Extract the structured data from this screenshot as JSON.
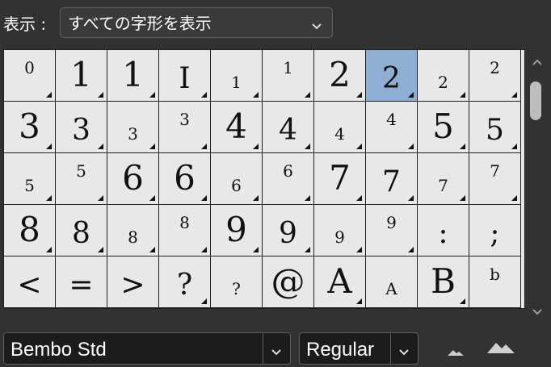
{
  "toolbar": {
    "show_label": "表示 :",
    "show_value": "すべての字形を表示"
  },
  "glyphs": [
    {
      "char": "0",
      "size": "sup",
      "alternates": true,
      "selected": false
    },
    {
      "char": "1",
      "size": "big",
      "alternates": true,
      "selected": false
    },
    {
      "char": "1",
      "size": "big",
      "alternates": true,
      "selected": false
    },
    {
      "char": "I",
      "size": "mid",
      "alternates": true,
      "selected": false
    },
    {
      "char": "1",
      "size": "small",
      "alternates": true,
      "selected": false
    },
    {
      "char": "1",
      "size": "sup",
      "alternates": true,
      "selected": false
    },
    {
      "char": "2",
      "size": "big",
      "alternates": true,
      "selected": false
    },
    {
      "char": "2",
      "size": "mid",
      "alternates": true,
      "selected": true
    },
    {
      "char": "2",
      "size": "small",
      "alternates": true,
      "selected": false
    },
    {
      "char": "2",
      "size": "sup",
      "alternates": true,
      "selected": false
    },
    {
      "char": "3",
      "size": "big",
      "alternates": true,
      "selected": false
    },
    {
      "char": "3",
      "size": "mid",
      "alternates": true,
      "selected": false
    },
    {
      "char": "3",
      "size": "small",
      "alternates": true,
      "selected": false
    },
    {
      "char": "3",
      "size": "sup",
      "alternates": true,
      "selected": false
    },
    {
      "char": "4",
      "size": "big",
      "alternates": true,
      "selected": false
    },
    {
      "char": "4",
      "size": "mid",
      "alternates": true,
      "selected": false
    },
    {
      "char": "4",
      "size": "small",
      "alternates": true,
      "selected": false
    },
    {
      "char": "4",
      "size": "sup",
      "alternates": true,
      "selected": false
    },
    {
      "char": "5",
      "size": "big",
      "alternates": true,
      "selected": false
    },
    {
      "char": "5",
      "size": "mid",
      "alternates": true,
      "selected": false
    },
    {
      "char": "5",
      "size": "small",
      "alternates": true,
      "selected": false
    },
    {
      "char": "5",
      "size": "sup",
      "alternates": true,
      "selected": false
    },
    {
      "char": "6",
      "size": "big",
      "alternates": true,
      "selected": false
    },
    {
      "char": "6",
      "size": "big",
      "alternates": true,
      "selected": false
    },
    {
      "char": "6",
      "size": "small",
      "alternates": true,
      "selected": false
    },
    {
      "char": "6",
      "size": "sup",
      "alternates": true,
      "selected": false
    },
    {
      "char": "7",
      "size": "big",
      "alternates": true,
      "selected": false
    },
    {
      "char": "7",
      "size": "mid",
      "alternates": true,
      "selected": false
    },
    {
      "char": "7",
      "size": "small",
      "alternates": true,
      "selected": false
    },
    {
      "char": "7",
      "size": "sup",
      "alternates": true,
      "selected": false
    },
    {
      "char": "8",
      "size": "big",
      "alternates": true,
      "selected": false
    },
    {
      "char": "8",
      "size": "mid",
      "alternates": true,
      "selected": false
    },
    {
      "char": "8",
      "size": "small",
      "alternates": true,
      "selected": false
    },
    {
      "char": "8",
      "size": "sup",
      "alternates": true,
      "selected": false
    },
    {
      "char": "9",
      "size": "big",
      "alternates": true,
      "selected": false
    },
    {
      "char": "9",
      "size": "mid",
      "alternates": true,
      "selected": false
    },
    {
      "char": "9",
      "size": "small",
      "alternates": true,
      "selected": false
    },
    {
      "char": "9",
      "size": "sup",
      "alternates": true,
      "selected": false
    },
    {
      "char": ":",
      "size": "mid",
      "alternates": false,
      "selected": false
    },
    {
      "char": ";",
      "size": "mid",
      "alternates": false,
      "selected": false
    },
    {
      "char": "<",
      "size": "mid",
      "alternates": false,
      "selected": false
    },
    {
      "char": "=",
      "size": "mid",
      "alternates": false,
      "selected": false
    },
    {
      "char": ">",
      "size": "mid",
      "alternates": false,
      "selected": false
    },
    {
      "char": "?",
      "size": "mid",
      "alternates": true,
      "selected": false
    },
    {
      "char": "?",
      "size": "small",
      "alternates": false,
      "selected": false
    },
    {
      "char": "@",
      "size": "big",
      "alternates": false,
      "selected": false
    },
    {
      "char": "A",
      "size": "big",
      "alternates": true,
      "selected": false
    },
    {
      "char": "A",
      "size": "small",
      "alternates": false,
      "selected": false
    },
    {
      "char": "B",
      "size": "big",
      "alternates": true,
      "selected": false
    },
    {
      "char": "b",
      "size": "sup",
      "alternates": false,
      "selected": false
    }
  ],
  "footer": {
    "font_family": "Bembo Std",
    "font_style": "Regular",
    "size_down_icon": "mountain-small-icon",
    "size_up_icon": "mountain-large-icon"
  },
  "colors": {
    "panel_bg": "#323232",
    "cell_bg": "#e8e8e8",
    "selected_bg": "#8eafd3",
    "glyph": "#111111"
  }
}
